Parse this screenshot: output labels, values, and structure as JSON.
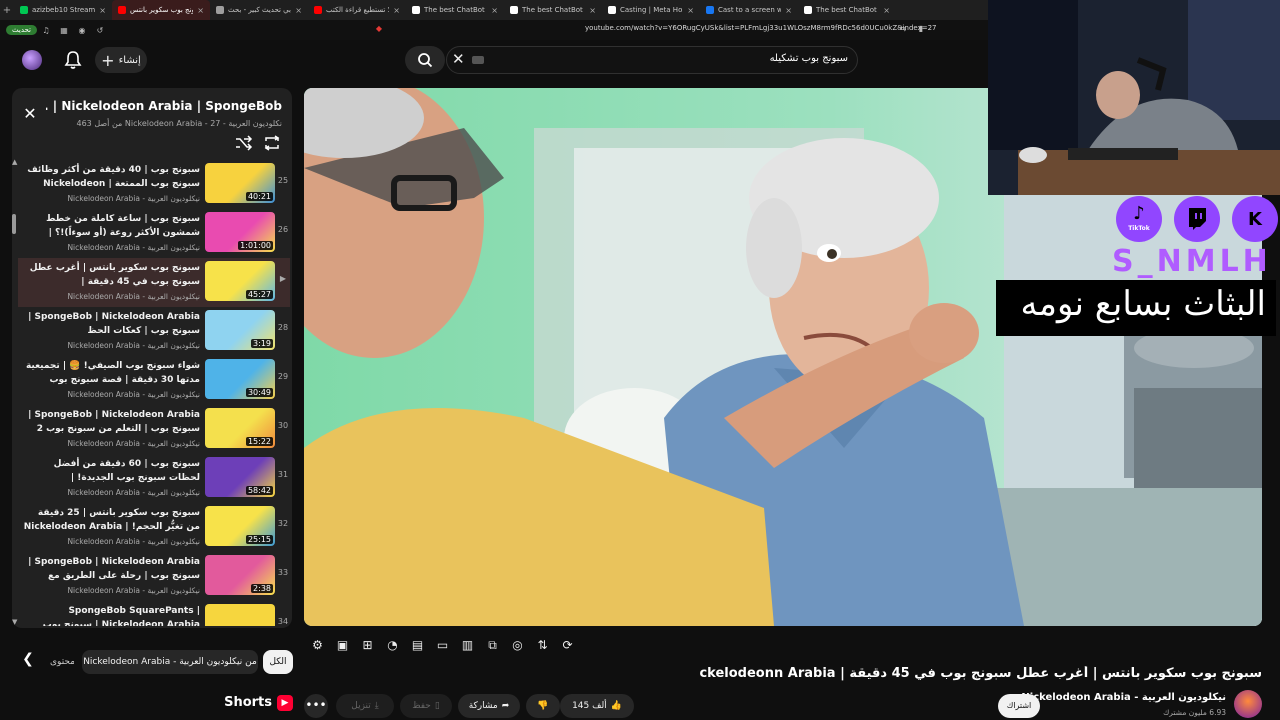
{
  "browser": {
    "tabs": [
      {
        "label": "azizbeb10 Stream - Watch",
        "color": "#00c853",
        "active": false
      },
      {
        "label": "سبونج بوب سكوير بانتس",
        "color": "#ff0000",
        "active": true
      },
      {
        "label": "كيف بي تحديث كبير - بحث",
        "color": "#9e9e9e",
        "active": false
      },
      {
        "label": "لماذا لا تستطيع قراءة الكتب",
        "color": "#ff0000",
        "active": false
      },
      {
        "label": "The best ChatBot and Wid",
        "color": "#ffffff",
        "active": false
      },
      {
        "label": "The best ChatBot and Wid",
        "color": "#ffffff",
        "active": false
      },
      {
        "label": "Casting | Meta Horizon",
        "color": "#ffffff",
        "active": false
      },
      {
        "label": "Cast to a screen with Meta",
        "color": "#1877f2",
        "active": false
      },
      {
        "label": "The best ChatBot and Wid",
        "color": "#ffffff",
        "active": false
      }
    ],
    "update_label": "تحديث",
    "url": "youtube.com/watch?v=Y6ORugCyUSk&list=PLFmLgj33u1WLOszM8rm9fRDc56d0UCu0kZ&index=27"
  },
  "header": {
    "create_label": "إنشاء",
    "search_value": "سبونج بوب تشكيله"
  },
  "playlist": {
    "title": "Nickelodeon Arabia | SpongeBob | ...",
    "subtitle": "نكلوديون العربية - Nickelodeon Arabia - 27 من أصل 463",
    "items": [
      {
        "num": "25",
        "title": "سبونج بوب | 40 دقيقة من أكثر وظائف سبونج بوب الممتعة | Nickelodeon Arabia",
        "channel": "نيكلوديون العربية - Nickelodeon Arabia",
        "duration": "40:21",
        "current": false,
        "c1": "#f7d23e",
        "c2": "#3b8fd9"
      },
      {
        "num": "26",
        "title": "سبونج بوب | ساعة كاملة من خطط شمشون الأكثر روعة (أو سوءاً)!؟ | Nickelodeon Arabia",
        "channel": "نيكلوديون العربية - Nickelodeon Arabia",
        "duration": "1:01:00",
        "current": false,
        "c1": "#e94bb0",
        "c2": "#f5e04a"
      },
      {
        "num": "",
        "title": "سبونج بوب سكوير بانتس | أغرب عطل سبونج بوب في 45 دقيقة | Nickelodeonn Arabia",
        "channel": "نيكلوديون العربية - Nickelodeon Arabia",
        "duration": "45:27",
        "current": true,
        "c1": "#f7e24a",
        "c2": "#5db7e8"
      },
      {
        "num": "28",
        "title": "SpongeBob | Nickelodeon Arabia | سبونج بوب | كعكات الحظ",
        "channel": "نيكلوديون العربية - Nickelodeon Arabia",
        "duration": "3:19",
        "current": false,
        "c1": "#8fd3f0",
        "c2": "#f2e36a"
      },
      {
        "num": "29",
        "title": "شواء سبونج بوب الصيفي! 🍔 | تجميعية مدتها 30 دقيقة | قصة سبونج بوب الرسمية | سبونج بوب |...",
        "channel": "نيكلوديون العربية - Nickelodeon Arabia",
        "duration": "30:49",
        "current": false,
        "c1": "#4fb3e8",
        "c2": "#f7d04a"
      },
      {
        "num": "30",
        "title": "SpongeBob | Nickelodeon Arabia | سبونج بوب | التعلم من سبونج بوب 2",
        "channel": "نيكلوديون العربية - Nickelodeon Arabia",
        "duration": "15:22",
        "current": false,
        "c1": "#f4e04d",
        "c2": "#f08a3c"
      },
      {
        "num": "31",
        "title": "سبونج بوب | 60 دقيقة من أفضل لحظات سبونج بوب الجديدة! | Nickelodeon Arabia",
        "channel": "نيكلوديون العربية - Nickelodeon Arabia",
        "duration": "58:42",
        "current": false,
        "c1": "#6d3fb8",
        "c2": "#f7d83e"
      },
      {
        "num": "32",
        "title": "سبونج بوب سكوير بانتس | 25 دقيقة من تغيُّر الحجم! | Nickelodeon Arabia",
        "channel": "نيكلوديون العربية - Nickelodeon Arabia",
        "duration": "25:15",
        "current": false,
        "c1": "#f7e24a",
        "c2": "#3c9ad6"
      },
      {
        "num": "33",
        "title": "SpongeBob | Nickelodeon Arabia | سبونج بوب | رحلة على الطريق مع الطاهر!",
        "channel": "نيكلوديون العربية - Nickelodeon Arabia",
        "duration": "2:38",
        "current": false,
        "c1": "#e25a9c",
        "c2": "#f6e04c"
      },
      {
        "num": "34",
        "title": "SpongeBob SquarePants | Nickelodeon Arabia | سبونج بوب",
        "channel": "",
        "duration": "",
        "current": false,
        "c1": "#f6d63e",
        "c2": "#f6d63e"
      }
    ]
  },
  "overlay": {
    "social_k": "K",
    "social_tiktok_label": "TikTok",
    "brand": "S_NMLH",
    "banner": "البثاث بسابع نومه"
  },
  "chips": {
    "partial": "محتوى",
    "channel": "من نيكلوديون العربية - Nickelodeon Arabia",
    "all": "الكل"
  },
  "shorts_label": "Shorts",
  "video": {
    "title": "سبونج بوب سكوير بانتس | أغرب عطل سبونج بوب في 45 دقيقة | Nickelodeonn Arabia",
    "channel": "نيكلوديون العربية - Nickelodeon Arabia",
    "subscribers": "6.93 مليون مشترك",
    "subscribe_label": "اشتراك",
    "likes": "145 ألف",
    "share_label": "مشاركة",
    "save_label": "حفظ",
    "download_label": "تنزيل"
  }
}
